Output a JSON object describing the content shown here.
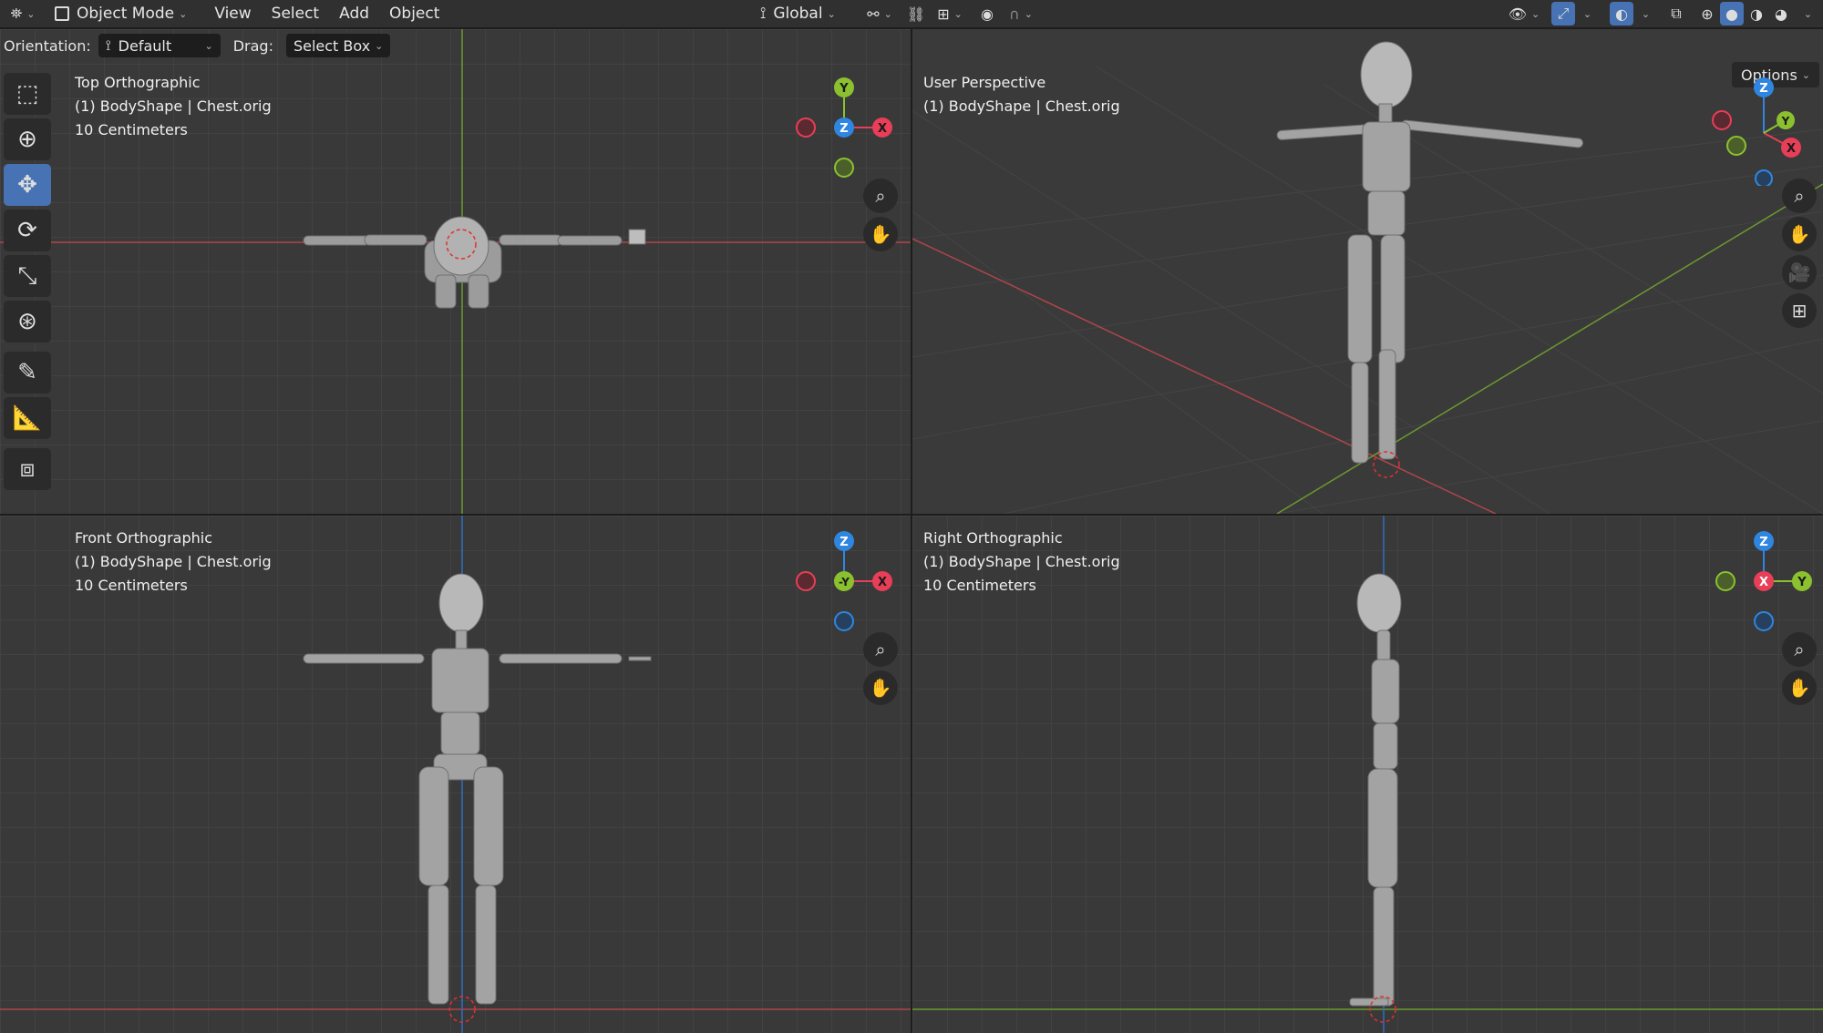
{
  "header": {
    "mode": "Object Mode",
    "menus": [
      "View",
      "Select",
      "Add",
      "Object"
    ],
    "transform_orientation": "Global",
    "options_label": "Options"
  },
  "subheader": {
    "orientation_label": "Orientation:",
    "orientation_value": "Default",
    "drag_label": "Drag:",
    "drag_value": "Select Box"
  },
  "viewports": {
    "top": {
      "title": "Top Orthographic",
      "object": "(1) BodyShape | Chest.orig",
      "scale": "10 Centimeters",
      "gizmo": {
        "center": "Z",
        "right": "X",
        "up": "Y"
      }
    },
    "user": {
      "title": "User Perspective",
      "object": "(1) BodyShape | Chest.orig",
      "gizmo": {
        "up": "Z",
        "right": "X",
        "mid": "Y"
      }
    },
    "front": {
      "title": "Front Orthographic",
      "object": "(1) BodyShape | Chest.orig",
      "scale": "10 Centimeters",
      "gizmo": {
        "center": "-Y",
        "right": "X",
        "up": "Z"
      }
    },
    "right": {
      "title": "Right Orthographic",
      "object": "(1) BodyShape | Chest.orig",
      "scale": "10 Centimeters",
      "gizmo": {
        "center": "X",
        "right": "Y",
        "up": "Z"
      }
    }
  },
  "tools": [
    "select-box-icon",
    "cursor-icon",
    "move-icon",
    "rotate-icon",
    "scale-icon",
    "transform-icon",
    "annotate-icon",
    "measure-icon",
    "add-cube-icon"
  ],
  "colors": {
    "x_axis": "#e83e57",
    "y_axis": "#8bc12f",
    "z_axis": "#2f86e0",
    "active_tool": "#4772b3",
    "viewport_bg": "#393939"
  }
}
